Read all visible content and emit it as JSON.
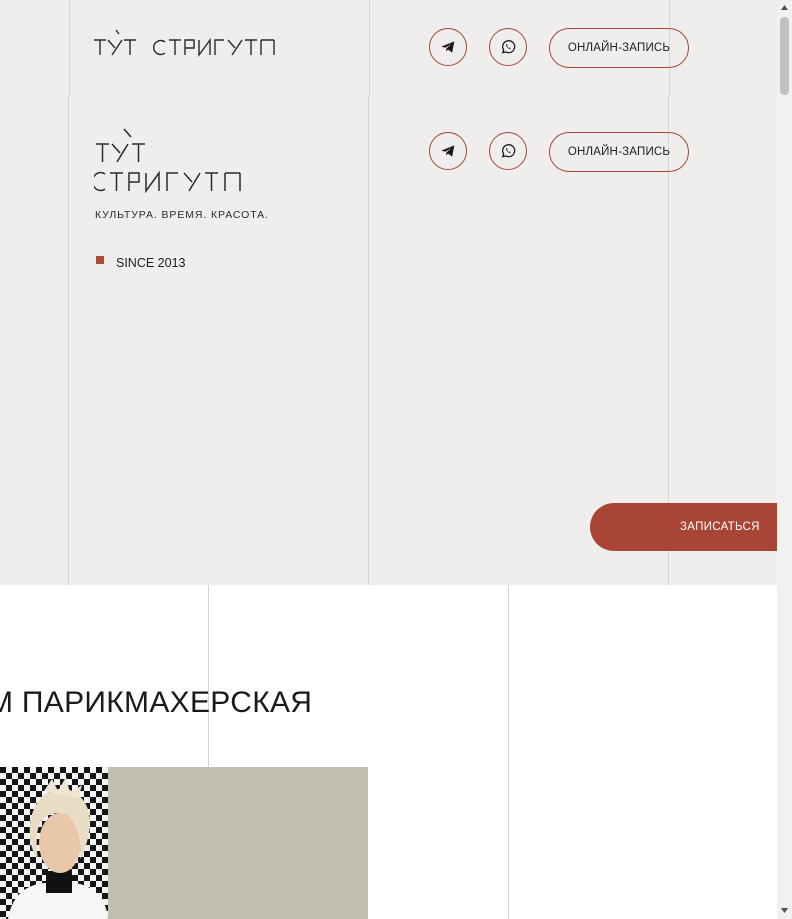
{
  "header": {
    "logo_alt": "ТУТ СТРИГУТ",
    "telegram_icon": "telegram-icon",
    "whatsapp_icon": "whatsapp-icon",
    "booking_label": "ОНЛАЙН-ЗАПИСЬ"
  },
  "hero": {
    "logo_alt": "ТУТ СТРИГУТ",
    "tagline": "КУЛЬТУРА. ВРЕМЯ. КРАСОТА.",
    "since": "SINCE 2013",
    "booking_label": "ОНЛАЙН-ЗАПИСЬ",
    "cta_label": "ЗАПИСАТЬСЯ"
  },
  "section": {
    "title": "М ПАРИКМАХЕРСКАЯ"
  },
  "colors": {
    "accent": "#a94536",
    "hero_bg": "#efeeec",
    "photo_block": "#c1bfb2"
  }
}
